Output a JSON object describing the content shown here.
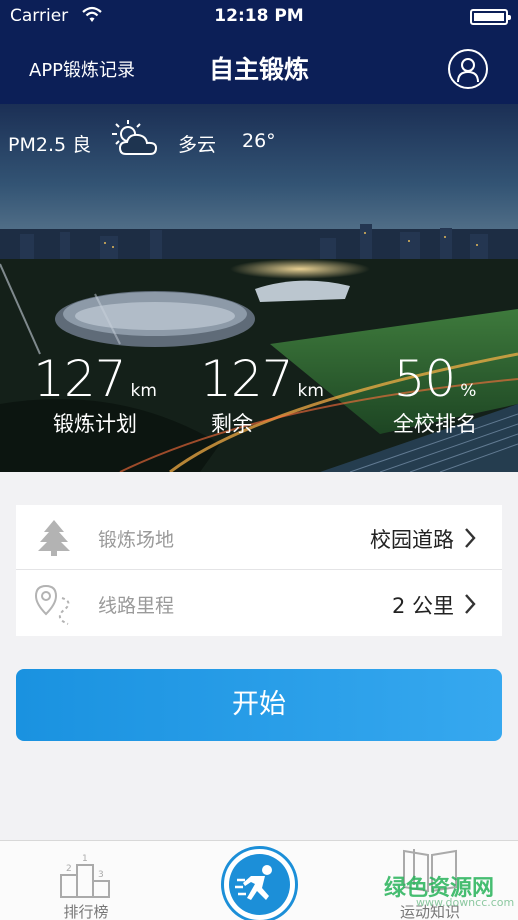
{
  "status_bar": {
    "carrier": "Carrier",
    "time": "12:18 PM"
  },
  "nav": {
    "left_link": "APP锻炼记录",
    "title": "自主锻炼",
    "user_icon": "user-circle-icon"
  },
  "weather": {
    "air": "PM2.5 良",
    "condition": "多云",
    "temperature": "26°",
    "icon": "partly-cloudy-icon"
  },
  "stats": [
    {
      "value": "127",
      "unit": "km",
      "label": "锻炼计划"
    },
    {
      "value": "127",
      "unit": "km",
      "label": "剩余"
    },
    {
      "value": "50",
      "unit": "%",
      "label": "全校排名"
    }
  ],
  "settings": {
    "venue": {
      "label": "锻炼场地",
      "value": "校园道路",
      "icon": "tree-icon"
    },
    "distance": {
      "label": "线路里程",
      "value": "2 公里",
      "icon": "route-pin-icon"
    }
  },
  "start_button": "开始",
  "tabs": [
    {
      "label": "排行榜",
      "icon": "podium-icon"
    },
    {
      "label": "",
      "icon": "running-man-icon"
    },
    {
      "label": "运动知识",
      "icon": "book-icon"
    }
  ],
  "watermark": {
    "text": "绿色资源网",
    "sub": "www.downcc.com"
  },
  "colors": {
    "navy": "#0c1f57",
    "accent_blue": "#1c8fd8",
    "button_blue": "#2a9ee8"
  }
}
